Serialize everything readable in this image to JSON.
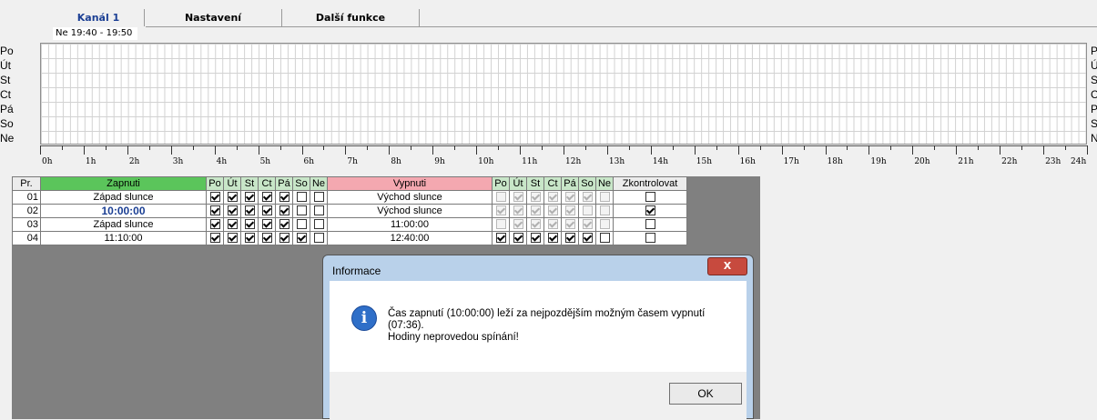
{
  "tabs": [
    "Kanál 1",
    "Nastavení",
    "Další funkce"
  ],
  "time_tooltip": "Ne 19:40 - 19:50",
  "days": [
    "Po",
    "Út",
    "St",
    "Ct",
    "Pá",
    "So",
    "Ne"
  ],
  "hours": [
    "0h",
    "1h",
    "2h",
    "3h",
    "4h",
    "5h",
    "6h",
    "7h",
    "8h",
    "9h",
    "10h",
    "11h",
    "12h",
    "13h",
    "14h",
    "15h",
    "16h",
    "17h",
    "18h",
    "19h",
    "20h",
    "21h",
    "22h",
    "23h",
    "24h"
  ],
  "table": {
    "headers": {
      "pr": "Pr.",
      "on": "Zapnuti",
      "off": "Vypnuti",
      "check": "Zkontrolovat",
      "days": [
        "Po",
        "Út",
        "St",
        "Ct",
        "Pá",
        "So",
        "Ne"
      ]
    },
    "rows": [
      {
        "pr": "01",
        "on": "Západ slunce",
        "on_days": [
          1,
          1,
          1,
          1,
          1,
          0,
          0
        ],
        "off": "Východ slunce",
        "off_days": [
          0,
          1,
          1,
          1,
          1,
          1,
          0
        ],
        "off_disabled": true,
        "check": 0
      },
      {
        "pr": "02",
        "on": "10:00:00",
        "on_bold": true,
        "on_days": [
          1,
          1,
          1,
          1,
          1,
          0,
          0
        ],
        "off": "Východ slunce",
        "off_days": [
          1,
          1,
          1,
          1,
          1,
          0,
          0
        ],
        "off_disabled": true,
        "check": 1
      },
      {
        "pr": "03",
        "on": "Západ slunce",
        "on_days": [
          1,
          1,
          1,
          1,
          1,
          0,
          0
        ],
        "off": "11:00:00",
        "off_days": [
          0,
          1,
          1,
          1,
          1,
          1,
          0
        ],
        "off_disabled": true,
        "check": 0
      },
      {
        "pr": "04",
        "on": "11:10:00",
        "on_days": [
          1,
          1,
          1,
          1,
          1,
          1,
          0
        ],
        "off": "12:40:00",
        "off_days": [
          1,
          1,
          1,
          1,
          1,
          1,
          0
        ],
        "off_disabled": false,
        "check": 0
      }
    ]
  },
  "dialog": {
    "title": "Informace",
    "close": "X",
    "line1": "Čas zapnutí (10:00:00) leží za nejpozdějším možným časem vypnutí",
    "line2": "(07:36).",
    "line3": "Hodiny neprovedou spínání!",
    "ok": "OK",
    "icon": "info-icon"
  }
}
